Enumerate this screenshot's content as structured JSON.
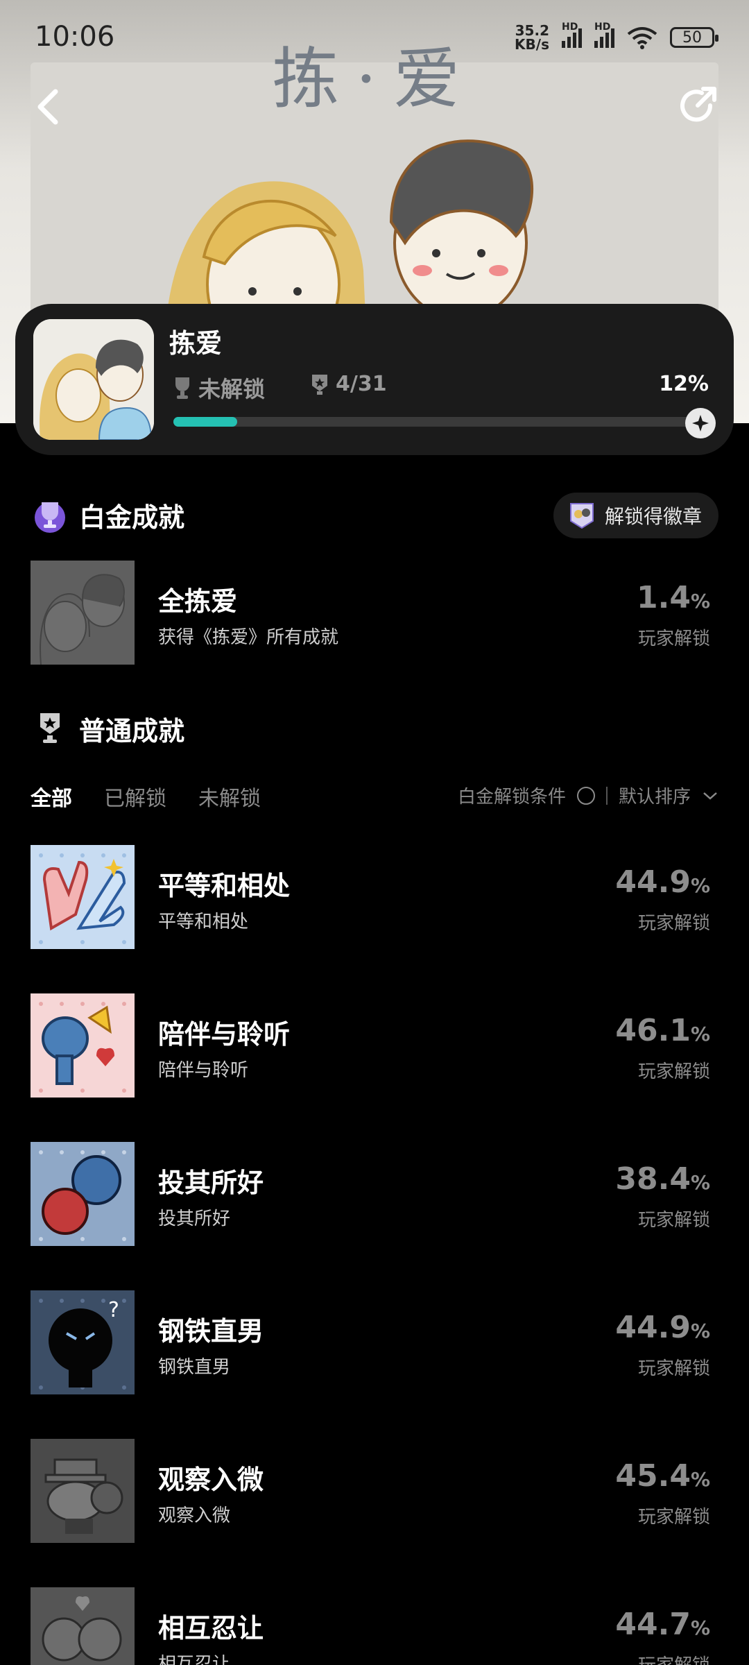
{
  "status_bar": {
    "time": "10:06",
    "net_speed_value": "35.2",
    "net_speed_unit": "KB/s",
    "sim1": "HD",
    "sim2": "HD",
    "battery": "50"
  },
  "banner": {
    "art_title": "拣·爱"
  },
  "game": {
    "title": "拣爱",
    "lock_state": "未解锁",
    "trophy_count": "4/31",
    "progress_label": "12%",
    "progress_fraction": 0.12
  },
  "platinum": {
    "section_title": "白金成就",
    "badge_button": "解锁得徽章",
    "item": {
      "name": "全拣爱",
      "desc": "获得《拣爱》所有成就",
      "pct": "1.4",
      "pct_unit": "%",
      "sub": "玩家解锁"
    }
  },
  "normal": {
    "section_title": "普通成就",
    "tabs": [
      "全部",
      "已解锁",
      "未解锁"
    ],
    "condition_label": "白金解锁条件",
    "sort_label": "默认排序",
    "items": [
      {
        "name": "平等和相处",
        "desc": "平等和相处",
        "pct": "44.9",
        "unit": "%",
        "sub": "玩家解锁"
      },
      {
        "name": "陪伴与聆听",
        "desc": "陪伴与聆听",
        "pct": "46.1",
        "unit": "%",
        "sub": "玩家解锁"
      },
      {
        "name": "投其所好",
        "desc": "投其所好",
        "pct": "38.4",
        "unit": "%",
        "sub": "玩家解锁"
      },
      {
        "name": "钢铁直男",
        "desc": "钢铁直男",
        "pct": "44.9",
        "unit": "%",
        "sub": "玩家解锁"
      },
      {
        "name": "观察入微",
        "desc": "观察入微",
        "pct": "45.4",
        "unit": "%",
        "sub": "玩家解锁"
      },
      {
        "name": "相互忍让",
        "desc": "相互忍让",
        "pct": "44.7",
        "unit": "%",
        "sub": "玩家解锁"
      }
    ]
  },
  "colors": {
    "accent": "#25c1b3",
    "background": "#000000",
    "card": "#1b1b1b"
  }
}
